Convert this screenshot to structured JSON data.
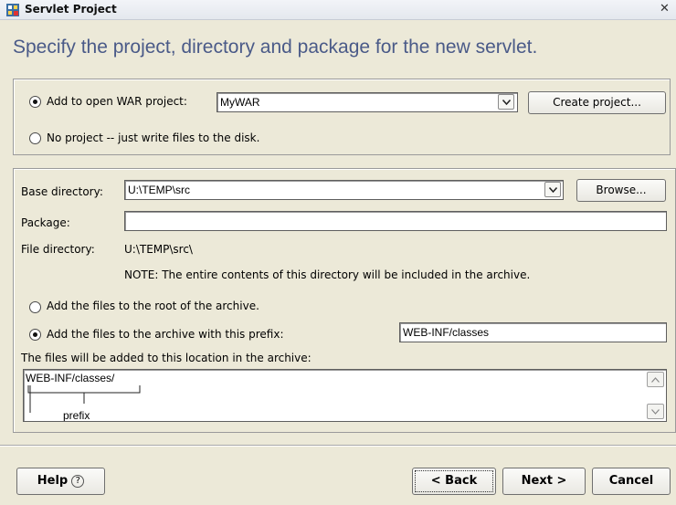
{
  "window": {
    "title": "Servlet Project",
    "close_glyph": "✕"
  },
  "heading": "Specify the project, directory and package for the new servlet.",
  "project": {
    "add_label": "Add to open WAR project:",
    "war_value": "MyWAR",
    "create_button": "Create project...",
    "noproject_label": "No project -- just write files to the disk.",
    "add_checked": true
  },
  "dir": {
    "base_label": "Base directory:",
    "base_value": "U:\\TEMP\\src",
    "browse_button": "Browse...",
    "package_label": "Package:",
    "package_value": "",
    "filedir_label": "File directory:",
    "filedir_value": "U:\\TEMP\\src\\",
    "note": "NOTE: The entire contents of this directory will be included in the archive.",
    "root_label": "Add the files to the root of the archive.",
    "prefix_label": "Add the files to the archive with this prefix:",
    "prefix_value": "WEB-INF/classes",
    "location_label": "The files will be added to this location in the archive:",
    "path_text": "WEB-INF/classes/",
    "prefix_caption": "prefix"
  },
  "buttons": {
    "help": "Help",
    "help_glyph": "?",
    "back": "< Back",
    "next": "Next >",
    "cancel": "Cancel"
  },
  "colors": {
    "heading": "#4a5a88",
    "background": "#ece9d8"
  },
  "icons": {
    "title_icon": "servlet-project-icon",
    "dropdown": "chevron-down-icon"
  }
}
